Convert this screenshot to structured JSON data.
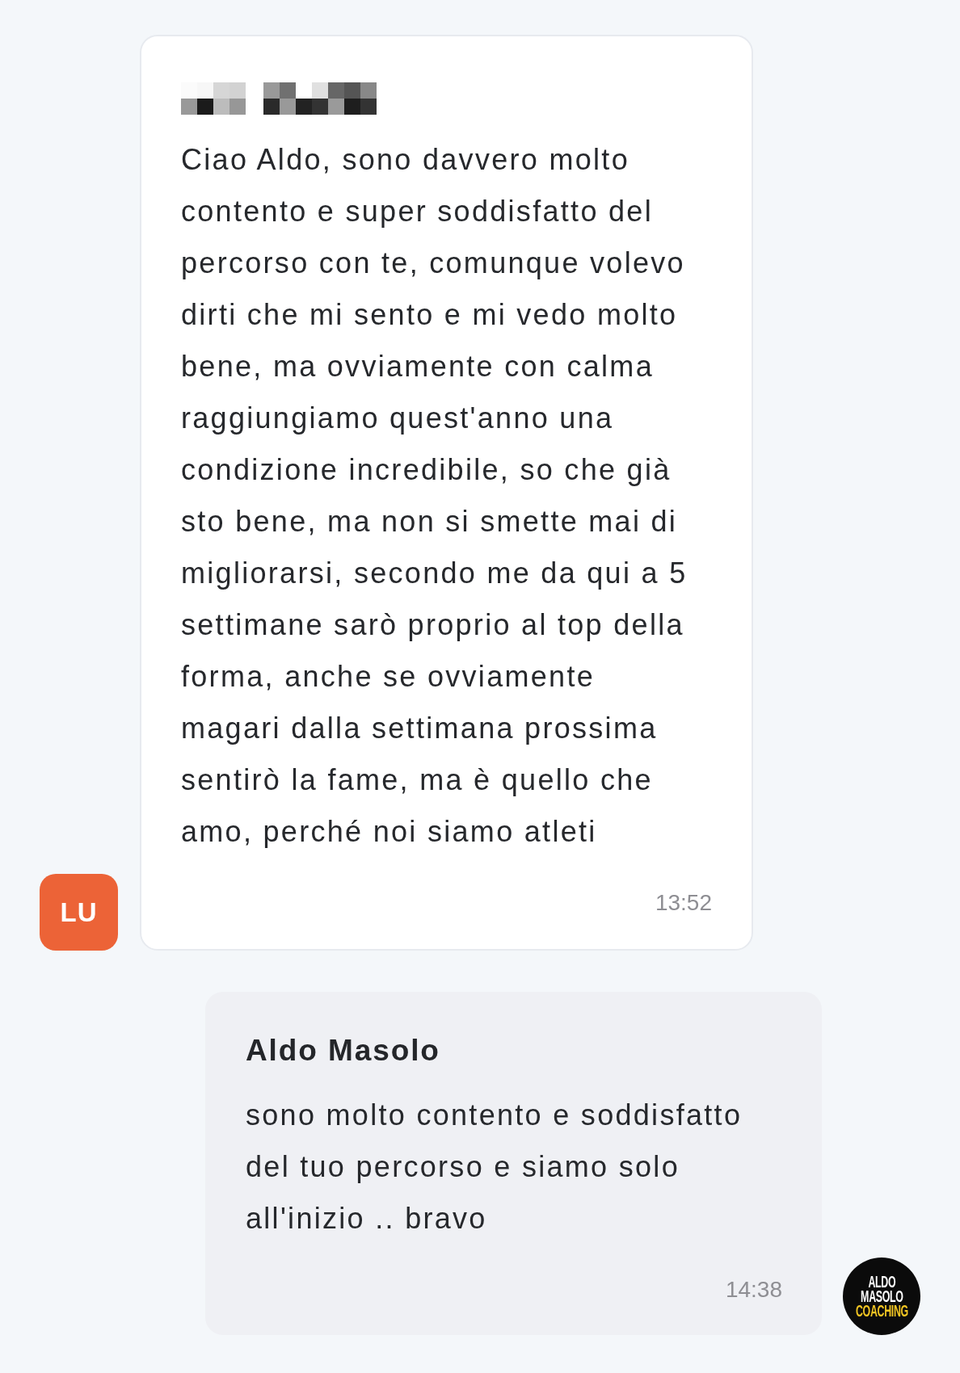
{
  "messages": [
    {
      "kind": "received",
      "sender_redacted": true,
      "text": "Ciao Aldo, sono davvero molto contento e super soddisfatto del percorso con te, comunque volevo dirti che mi sento e mi vedo molto bene, ma ovviamente con calma raggiungiamo quest'anno una condizione incredibile, so che già sto bene, ma non si smette mai di migliorarsi, secondo me da qui a 5 settimane sarò proprio al top della forma, anche se ovviamente magari dalla settimana prossima sentirò la fame, ma è quello che amo, perché noi siamo atleti",
      "time": "13:52",
      "avatar": {
        "kind": "initials",
        "initials": "LU"
      }
    },
    {
      "kind": "sent",
      "sender": "Aldo Masolo",
      "text": "sono molto contento e soddisfatto del tuo percorso e siamo solo all'inizio .. bravo",
      "time": "14:38",
      "avatar": {
        "kind": "logo",
        "lines": [
          {
            "text": "ALDO",
            "kind": "name"
          },
          {
            "text": "MASOLO",
            "kind": "name"
          },
          {
            "text": "COACHING",
            "kind": "tagline"
          }
        ]
      }
    }
  ]
}
